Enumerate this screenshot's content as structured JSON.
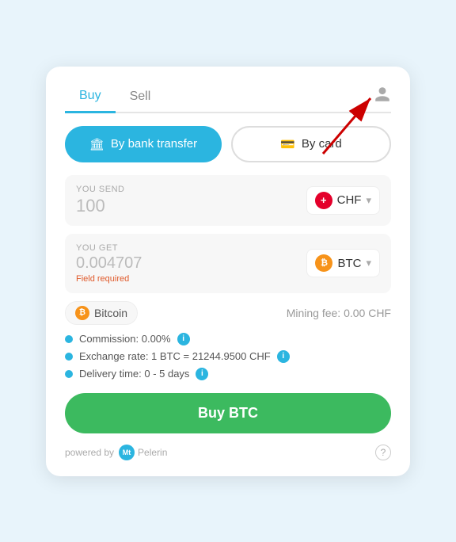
{
  "tabs": {
    "buy_label": "Buy",
    "sell_label": "Sell",
    "active": "buy"
  },
  "payment": {
    "bank_label": "By bank transfer",
    "card_label": "By card",
    "bank_icon": "🏛",
    "card_icon": "💳"
  },
  "send": {
    "label": "YOU SEND",
    "value": "100",
    "currency": "CHF",
    "flag": "+"
  },
  "get": {
    "label": "YOU GET",
    "value": "0.004707",
    "field_required": "Field required",
    "currency": "BTC"
  },
  "info": {
    "coin_name": "Bitcoin",
    "mining_fee": "Mining fee: 0.00 CHF"
  },
  "details": {
    "commission": "Commission: 0.00%",
    "exchange_rate": "Exchange rate: 1 BTC = 21244.9500 CHF",
    "delivery": "Delivery time: 0 - 5 days"
  },
  "buy_button": "Buy BTC",
  "footer": {
    "powered_by": "powered by",
    "brand": "Mt\nPelerin"
  },
  "colors": {
    "blue": "#2bb5e0",
    "green": "#3cba5f",
    "orange": "#f7931a",
    "red_flag": "#e4002b"
  }
}
